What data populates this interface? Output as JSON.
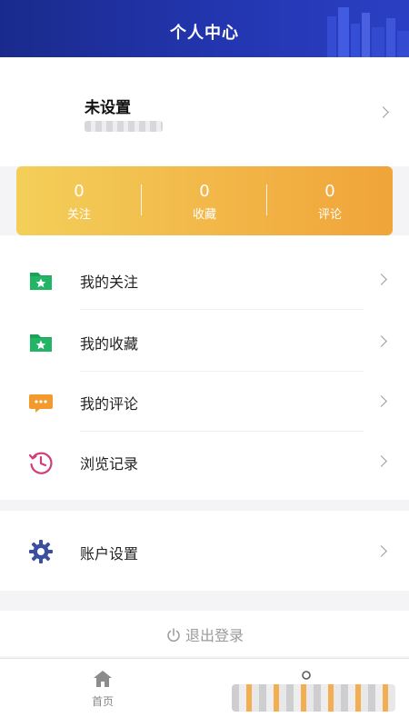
{
  "header": {
    "title": "个人中心"
  },
  "profile": {
    "name": "未设置"
  },
  "stats": [
    {
      "value": "0",
      "label": "关注"
    },
    {
      "value": "0",
      "label": "收藏"
    },
    {
      "value": "0",
      "label": "评论"
    }
  ],
  "menu": {
    "items": [
      {
        "label": "我的关注",
        "icon": "folder-star-icon"
      },
      {
        "label": "我的收藏",
        "icon": "folder-star-icon"
      },
      {
        "label": "我的评论",
        "icon": "comment-icon"
      },
      {
        "label": "浏览记录",
        "icon": "history-clock-icon"
      }
    ]
  },
  "account": {
    "label": "账户设置",
    "icon": "gear-icon"
  },
  "logout": {
    "label": "退出登录"
  },
  "tabbar": {
    "home_label": "首页"
  },
  "colors": {
    "header": "#2336b0",
    "stats_gradient_start": "#f3cf59",
    "stats_gradient_end": "#f0a43a",
    "folder_green": "#1fa05a",
    "comment_orange": "#f29a2e",
    "history_pink": "#d33c7a",
    "gear_blue": "#3b4fa0"
  }
}
